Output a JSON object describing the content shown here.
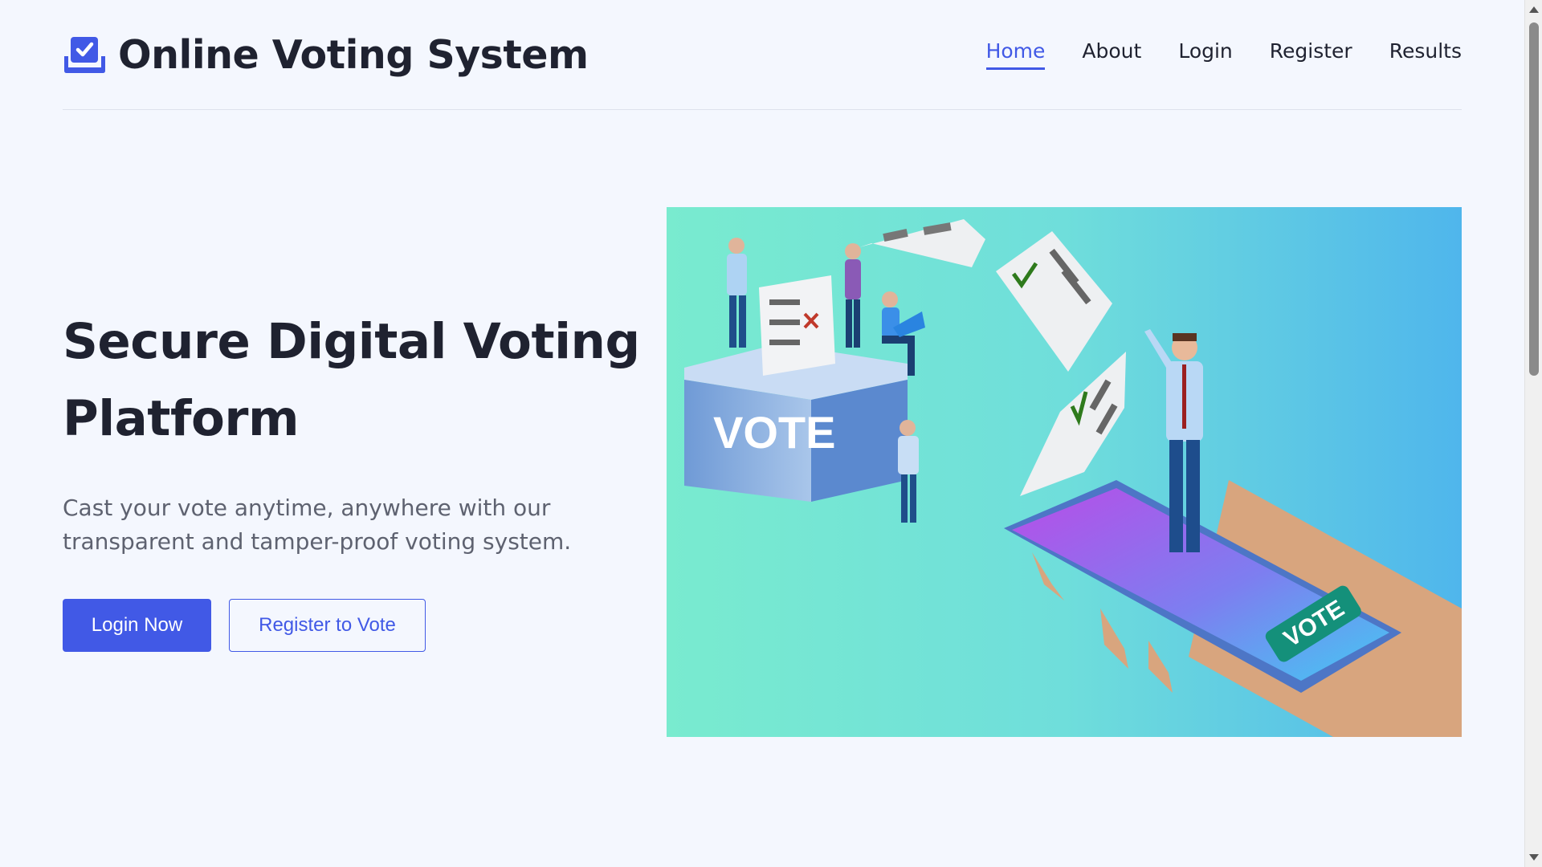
{
  "brand": {
    "title": "Online Voting System",
    "icon": "ballot-check-icon",
    "accent": "#4159e6"
  },
  "nav": {
    "home": "Home",
    "about": "About",
    "login": "Login",
    "register": "Register",
    "results": "Results"
  },
  "hero": {
    "title_line1": "Secure Digital Voting",
    "title_line2": "Platform",
    "subtitle": "Cast your vote anytime, anywhere with our transparent and tamper-proof voting system.",
    "login_button": "Login Now",
    "register_button": "Register to Vote"
  },
  "illustration": {
    "box_label": "VOTE",
    "phone_button_label": "VOTE"
  }
}
